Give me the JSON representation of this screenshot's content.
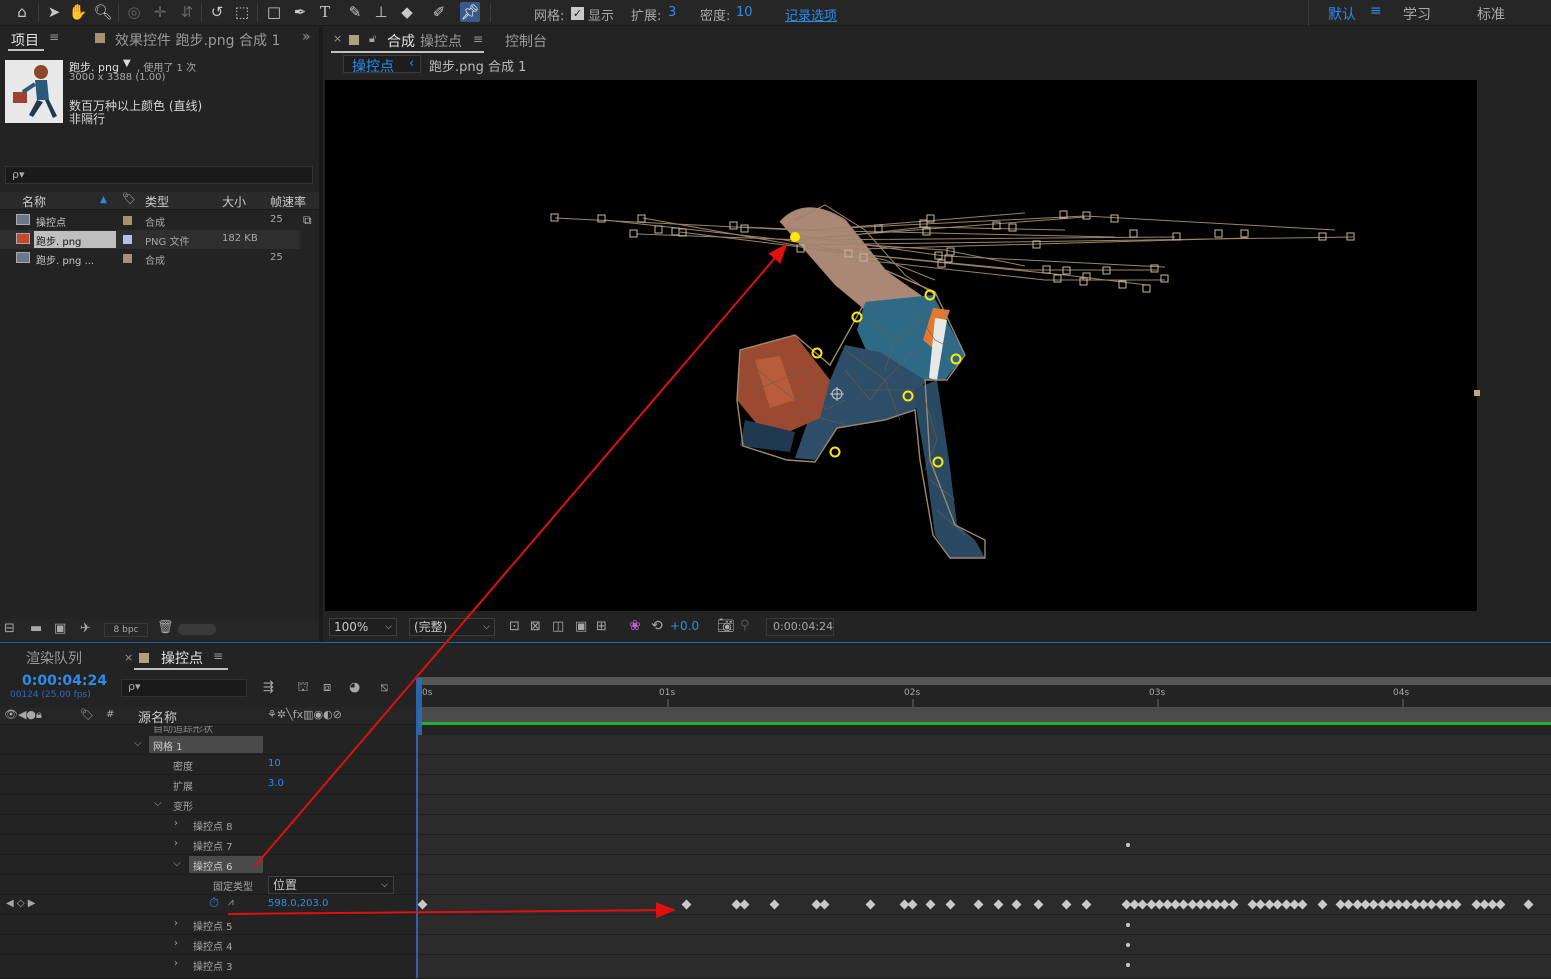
{
  "toolbar": {
    "mesh_label": "网格:",
    "show_label": "显示",
    "expand_label": "扩展:",
    "expand_value": "3",
    "density_label": "密度:",
    "density_value": "10",
    "record_options": "记录选项",
    "workspace_default": "默认",
    "workspace_menu": "≡",
    "workspace_learn": "学习",
    "workspace_standard": "标准"
  },
  "project": {
    "tab": "项目",
    "tab_menu": "≡",
    "effects_tab": "效果控件 跑步.png 合成 1",
    "more": "»",
    "file_name": "跑步. png",
    "file_used": ", 使用了 1 次",
    "file_dims": "3000 x 3388 (1.00)",
    "file_color": "数百万种以上颜色 (直线)",
    "file_interlace": "非隔行",
    "search_placeholder": "ρ▾",
    "col_name": "名称",
    "col_type": "类型",
    "col_size": "大小",
    "col_fps": "帧速率",
    "items": [
      {
        "name": "操控点",
        "type": "合成",
        "size": "",
        "fps": "25"
      },
      {
        "name": "跑步. png",
        "type": "PNG 文件",
        "size": "182 KB",
        "fps": ""
      },
      {
        "name": "跑步. png ...",
        "type": "合成",
        "size": "",
        "fps": "25"
      }
    ],
    "bpc": "8 bpc"
  },
  "comp": {
    "close": "×",
    "tab_prefix": "合成",
    "tab_name": "操控点",
    "tab_menu": "≡",
    "console_tab": "控制台",
    "breadcrumb_active": "操控点",
    "breadcrumb_sep": "‹",
    "breadcrumb_other": "跑步.png 合成 1",
    "zoom": "100%",
    "resolution": "(完整)",
    "exposure": "+0.0",
    "timecode": "0:00:04:24"
  },
  "timeline": {
    "render_queue": "渲染队列",
    "close": "×",
    "tab": "操控点",
    "tab_menu": "≡",
    "timecode": "0:00:04:24",
    "frames": "00124 (25.00 fps)",
    "source_name": "源名称",
    "hash": "#",
    "ruler": [
      "0s",
      "01s",
      "02s",
      "03s",
      "04s"
    ],
    "layers": [
      {
        "label": "网格 1",
        "value": ""
      },
      {
        "label": "密度",
        "value": "10"
      },
      {
        "label": "扩展",
        "value": "3.0"
      },
      {
        "label": "变形",
        "value": ""
      },
      {
        "label": "操控点 8",
        "value": ""
      },
      {
        "label": "操控点 7",
        "value": ""
      },
      {
        "label": "操控点 6",
        "value": ""
      },
      {
        "label": "固定类型",
        "value": "位置"
      },
      {
        "label": "",
        "value": "598.0,203.0"
      },
      {
        "label": "操控点 5",
        "value": ""
      },
      {
        "label": "操控点 4",
        "value": ""
      },
      {
        "label": "操控点 3",
        "value": ""
      }
    ]
  },
  "colors": {
    "accent": "#2d8ceb",
    "arrow": "#e01010",
    "pin": "#ffea00",
    "green_bar": "#23b12d"
  }
}
